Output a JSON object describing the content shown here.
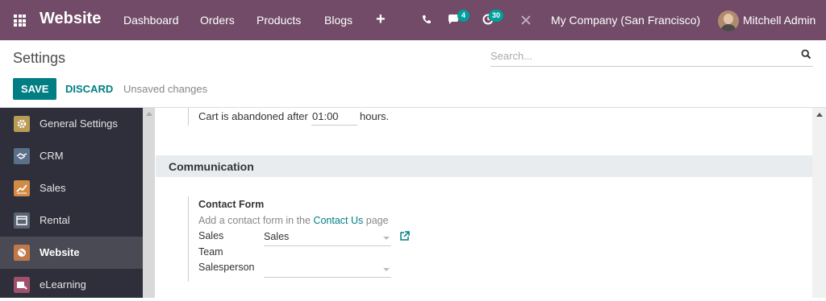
{
  "navbar": {
    "brand": "Website",
    "menu": [
      "Dashboard",
      "Orders",
      "Products",
      "Blogs"
    ],
    "plus_label": "+",
    "messages_count": "4",
    "activities_count": "30",
    "company": "My Company (San Francisco)",
    "user": "Mitchell Admin",
    "background_color": "#714B67",
    "badge_color": "#00A09D"
  },
  "control_panel": {
    "title": "Settings",
    "search_placeholder": "Search...",
    "save_label": "SAVE",
    "discard_label": "DISCARD",
    "status": "Unsaved changes"
  },
  "sidebar": {
    "items": [
      {
        "label": "General Settings",
        "icon": "gear-icon",
        "color": "#b89b54"
      },
      {
        "label": "CRM",
        "icon": "handshake-icon",
        "color": "#5a6f88"
      },
      {
        "label": "Sales",
        "icon": "chart-icon",
        "color": "#d28b45"
      },
      {
        "label": "Rental",
        "icon": "rental-icon",
        "color": "#5a6477"
      },
      {
        "label": "Website",
        "icon": "globe-icon",
        "color": "#c0784a",
        "active": true
      },
      {
        "label": "eLearning",
        "icon": "elearning-icon",
        "color": "#a0506a"
      }
    ]
  },
  "content": {
    "cart_label": "Cart is abandoned after",
    "cart_value": "01:00",
    "cart_unit": "hours.",
    "section_title": "Communication",
    "contact_form": {
      "title": "Contact Form",
      "desc_prefix": "Add a contact form in the",
      "desc_link": "Contact Us",
      "desc_suffix": "page",
      "sales_team_label_1": "Sales",
      "sales_team_label_2": "Team",
      "sales_team_value": "Sales",
      "salesperson_label": "Salesperson",
      "salesperson_value": ""
    }
  },
  "accent_color": "#017E84"
}
